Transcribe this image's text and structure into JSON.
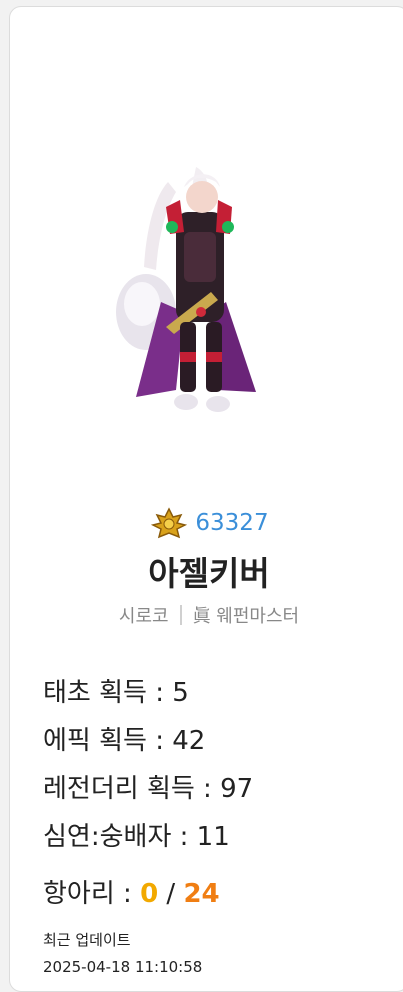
{
  "character": {
    "sprite_icon": "avatar-sprite-icon",
    "fame_icon": "fame-laurel-icon",
    "fame_value": "63327",
    "name": "아젤키버",
    "server": "시로코",
    "job": "眞 웨펀마스터"
  },
  "stats": {
    "taecho": "태초 획득 : 5",
    "epic": "에픽 획득 : 42",
    "legendary": "레전더리 획득 : 97",
    "abyss": "심연:숭배자 : 11",
    "hang_label": "항아리 : ",
    "hang_current": "0",
    "hang_sep": " / ",
    "hang_max": "24"
  },
  "update": {
    "label": "최근 업데이트",
    "time": "2025-04-18 11:10:58"
  },
  "colors": {
    "fame": "#3b8fd9",
    "hang_current": "#f2a900",
    "hang_max": "#f07e13"
  }
}
